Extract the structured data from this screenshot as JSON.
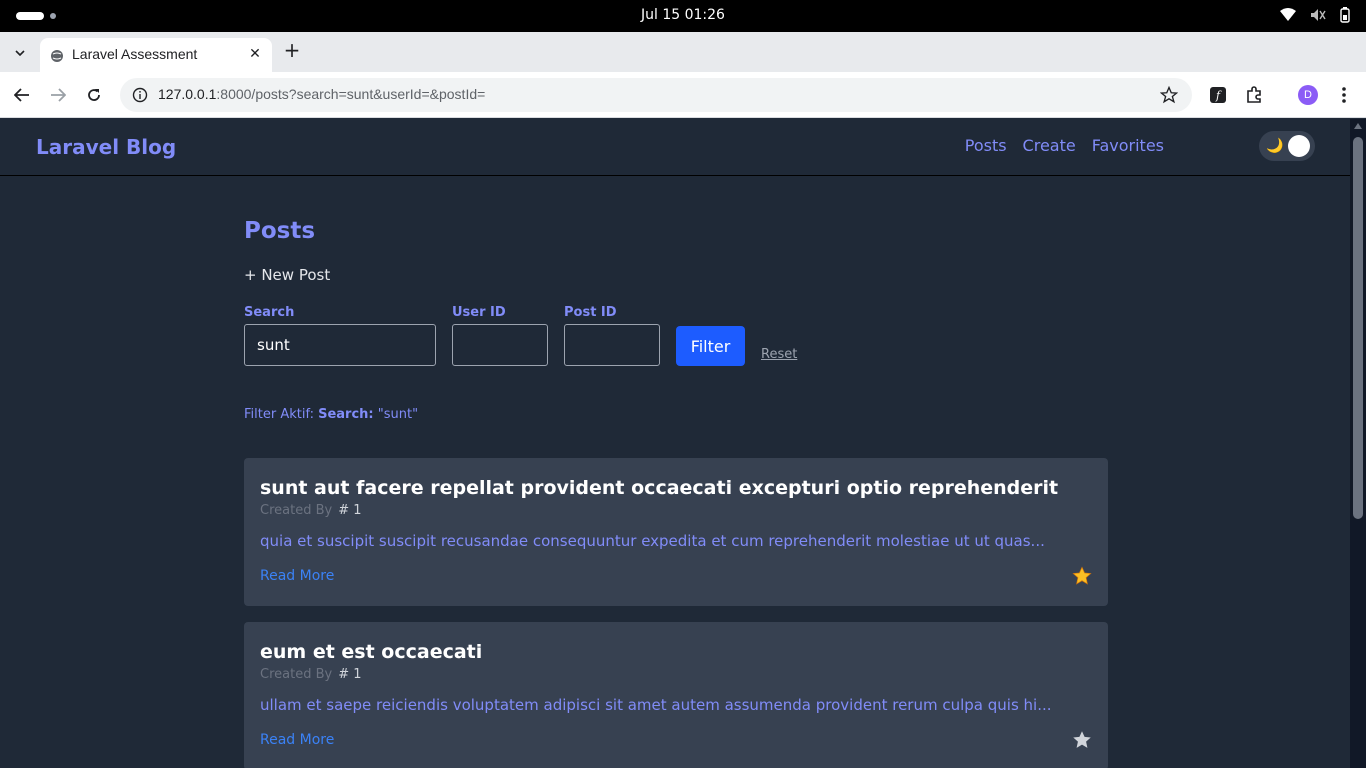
{
  "os": {
    "clock": "Jul 15  01:26"
  },
  "browser": {
    "tab_title": "Laravel Assessment",
    "url_host": "127.0.0.1",
    "url_rest": ":8000/posts?search=sunt&userId=&postId=",
    "avatar_letter": "D"
  },
  "site": {
    "brand": "Laravel Blog",
    "nav": [
      "Posts",
      "Create",
      "Favorites"
    ],
    "toggle_icon": "🌙"
  },
  "page": {
    "title": "Posts",
    "new_post": "+ New Post"
  },
  "filters": {
    "search_label": "Search",
    "search_value": "sunt",
    "user_label": "User ID",
    "user_value": "",
    "post_label": "Post ID",
    "post_value": "",
    "filter_button": "Filter",
    "reset_link": "Reset"
  },
  "active_filter": {
    "prefix": "Filter Aktif:",
    "key": "Search:",
    "value": "\"sunt\""
  },
  "posts": [
    {
      "title": "sunt aut facere repellat provident occaecati excepturi optio reprehenderit",
      "created_by_label": "Created By",
      "user": "# 1",
      "excerpt": "quia et suscipit suscipit recusandae consequuntur expedita et cum reprehenderit molestiae ut ut quas...",
      "read_more": "Read More",
      "favorited": true
    },
    {
      "title": "eum et est occaecati",
      "created_by_label": "Created By",
      "user": "# 1",
      "excerpt": "ullam et saepe reiciendis voluptatem adipisci sit amet autem assumenda provident rerum culpa quis hi...",
      "read_more": "Read More",
      "favorited": false
    }
  ],
  "colors": {
    "accent": "#818cf8",
    "primary_button": "#1d5cff",
    "star_active": "#fbbf24",
    "star_inactive": "#d1d5db",
    "card_bg": "#374151",
    "page_bg": "#1f2937"
  },
  "icons": [
    "wifi-icon",
    "mute-icon",
    "battery-icon",
    "back-icon",
    "forward-icon",
    "reload-icon",
    "info-icon",
    "bookmark-star-icon",
    "extension-icon",
    "puzzle-icon",
    "menu-icon",
    "star-icon",
    "moon-icon"
  ]
}
